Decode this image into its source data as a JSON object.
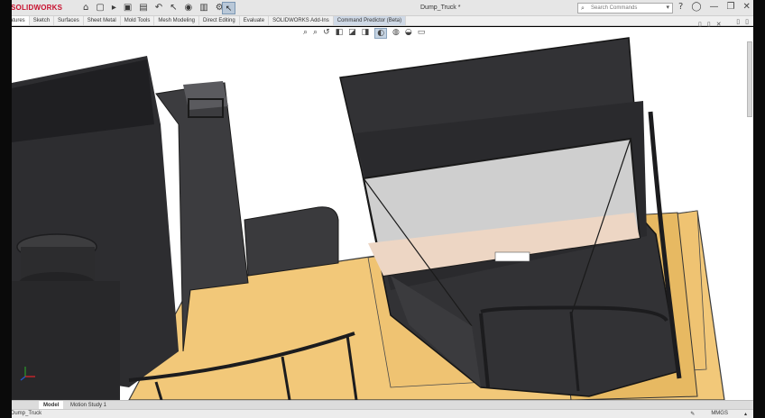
{
  "app": {
    "brand": "SOLIDWORKS",
    "document_title": "Dump_Truck *"
  },
  "quick_access": [
    {
      "icon": "home-icon",
      "glyph": "⌂"
    },
    {
      "icon": "new-file-icon",
      "glyph": "▢"
    },
    {
      "icon": "open-icon",
      "glyph": "▸"
    },
    {
      "icon": "save-icon",
      "glyph": "▣"
    },
    {
      "icon": "print-icon",
      "glyph": "▤"
    },
    {
      "icon": "undo-icon",
      "glyph": "↶"
    },
    {
      "icon": "select-arrow-icon",
      "glyph": "↖"
    },
    {
      "icon": "rebuild-icon",
      "glyph": "◉"
    },
    {
      "icon": "file-properties-icon",
      "glyph": "▥"
    },
    {
      "icon": "options-icon",
      "glyph": "⚙"
    }
  ],
  "search": {
    "placeholder": "Search Commands"
  },
  "title_right": [
    {
      "icon": "help-icon",
      "glyph": "?"
    },
    {
      "icon": "user-icon",
      "glyph": "◯"
    },
    {
      "icon": "minimize-icon",
      "glyph": "—"
    },
    {
      "icon": "restore-icon",
      "glyph": "❐"
    },
    {
      "icon": "close-icon",
      "glyph": "✕"
    }
  ],
  "command_tabs": [
    {
      "label": "Features",
      "state": "active"
    },
    {
      "label": "Sketch",
      "state": ""
    },
    {
      "label": "Surfaces",
      "state": ""
    },
    {
      "label": "Sheet Metal",
      "state": ""
    },
    {
      "label": "Mold Tools",
      "state": ""
    },
    {
      "label": "Mesh Modeling",
      "state": ""
    },
    {
      "label": "Direct Editing",
      "state": ""
    },
    {
      "label": "Evaluate",
      "state": ""
    },
    {
      "label": "SOLIDWORKS Add-Ins",
      "state": ""
    },
    {
      "label": "Command Predictor (Beta)",
      "state": "beta"
    }
  ],
  "heads_up_view": [
    {
      "icon": "zoom-to-fit-icon",
      "glyph": "⌕"
    },
    {
      "icon": "zoom-area-icon",
      "glyph": "⌕"
    },
    {
      "icon": "previous-view-icon",
      "glyph": "↺"
    },
    {
      "icon": "section-view-icon",
      "glyph": "◧"
    },
    {
      "icon": "view-orientation-icon",
      "glyph": "◪"
    },
    {
      "icon": "display-style-icon",
      "glyph": "◨"
    },
    {
      "icon": "hide-show-icon",
      "glyph": "◐"
    },
    {
      "icon": "edit-appearance-icon",
      "glyph": "◍"
    },
    {
      "icon": "apply-scene-icon",
      "glyph": "◒"
    },
    {
      "icon": "view-settings-icon",
      "glyph": "▭"
    }
  ],
  "bottom_tabs": {
    "model": "Model",
    "motion": "Motion Study 1"
  },
  "status": {
    "left": "Dump_Truck",
    "units": "MMGS"
  },
  "colors": {
    "body_dark": "#2e2e30",
    "deck_yellow": "#f2c879",
    "viewport_bg": "#ffffff",
    "ribbon_bg": "#f0f0f0"
  }
}
